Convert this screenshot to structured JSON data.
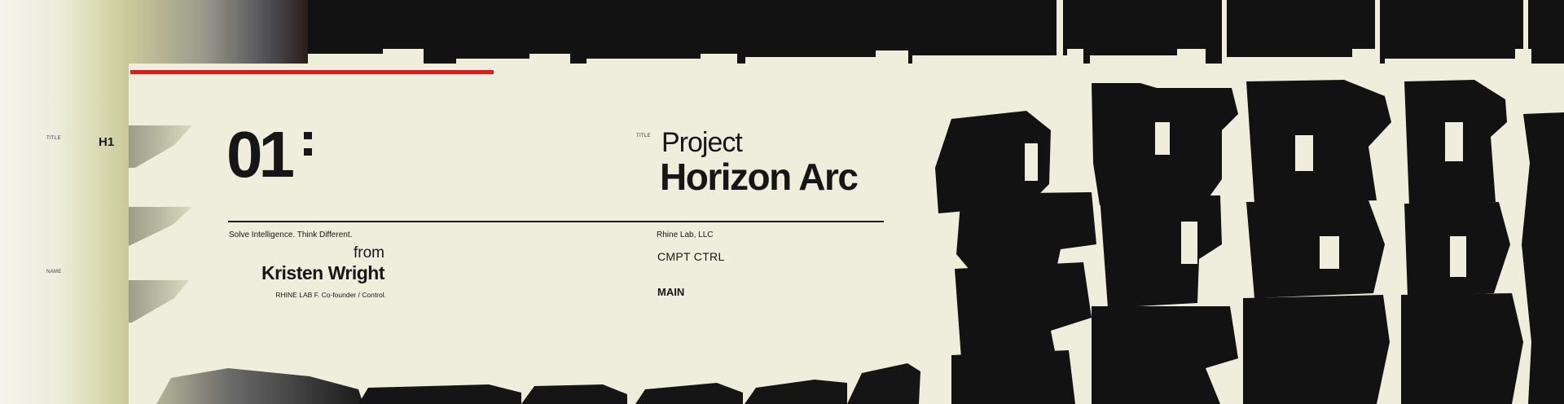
{
  "colors": {
    "background": "#efeedd",
    "ink": "#161616",
    "accent": "#d12121"
  },
  "left": {
    "field_title": "TITLE",
    "field_name": "NAME",
    "heading_level": "H1"
  },
  "slide": {
    "number": "01"
  },
  "project": {
    "meta_label": "TITLE",
    "word": "Project",
    "name": "Horizon Arc",
    "company": "Rhine Lab, LLC",
    "department": "CMPT CTRL",
    "section": "MAIN"
  },
  "credit": {
    "tagline": "Solve Intelligence. Think Different.",
    "from_label": "from",
    "author": "Kristen Wright",
    "role": "RHINE LAB  F. Co-founder / Control."
  }
}
